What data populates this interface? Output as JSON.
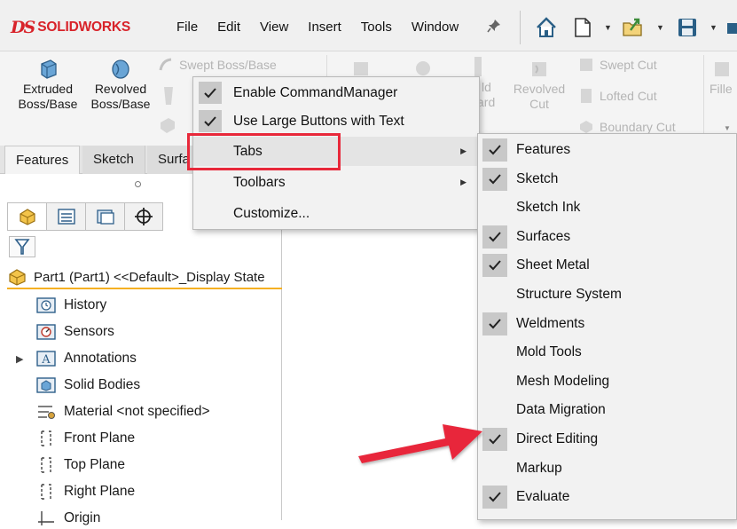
{
  "app": {
    "brand_ds": "DS",
    "brand_name_bold": "SOLID",
    "brand_name_rest": "WORKS",
    "accent_color": "#d8232a"
  },
  "menubar": {
    "items": [
      "File",
      "Edit",
      "View",
      "Insert",
      "Tools",
      "Window"
    ],
    "icons": [
      "pin-icon",
      "home-icon",
      "new-document-icon",
      "open-folder-icon",
      "save-icon"
    ]
  },
  "ribbon": {
    "extruded": "Extruded\nBoss/Base",
    "extruded_l1": "Extruded",
    "extruded_l2": "Boss/Base",
    "revolved_l1": "Revolved",
    "revolved_l2": "Boss/Base",
    "swept_boss": "Swept Boss/Base",
    "revolved_cut_l1": "Revolved",
    "revolved_cut_l2": "Cut",
    "swept_cut": "Swept Cut",
    "lofted_cut": "Lofted Cut",
    "boundary_cut": "Boundary Cut",
    "fillet_partial": "Fille",
    "partial_ld": "ld",
    "partial_ard": "ard"
  },
  "tabs": {
    "features": "Features",
    "sketch": "Sketch",
    "surfaces_partial": "Surfa"
  },
  "context_menu": {
    "items": [
      {
        "label": "Enable CommandManager",
        "checked": true,
        "submenu": false
      },
      {
        "label": "Use Large Buttons with Text",
        "checked": true,
        "submenu": false
      },
      {
        "label": "Tabs",
        "checked": false,
        "submenu": true
      },
      {
        "label": "Toolbars",
        "checked": false,
        "submenu": true
      },
      {
        "label": "Customize...",
        "checked": false,
        "submenu": false
      }
    ]
  },
  "tabs_submenu": {
    "items": [
      {
        "label": "Features",
        "checked": true
      },
      {
        "label": "Sketch",
        "checked": true
      },
      {
        "label": "Sketch Ink",
        "checked": false
      },
      {
        "label": "Surfaces",
        "checked": true
      },
      {
        "label": "Sheet Metal",
        "checked": true
      },
      {
        "label": "Structure System",
        "checked": false
      },
      {
        "label": "Weldments",
        "checked": true
      },
      {
        "label": "Mold Tools",
        "checked": false
      },
      {
        "label": "Mesh Modeling",
        "checked": false
      },
      {
        "label": "Data Migration",
        "checked": false
      },
      {
        "label": "Direct Editing",
        "checked": true
      },
      {
        "label": "Markup",
        "checked": false
      },
      {
        "label": "Evaluate",
        "checked": true
      }
    ]
  },
  "feature_tree": {
    "part": "Part1 (Part1) <<Default>_Display State",
    "items": [
      {
        "label": "History",
        "icon": "history-folder-icon"
      },
      {
        "label": "Sensors",
        "icon": "sensors-icon"
      },
      {
        "label": "Annotations",
        "icon": "annotations-icon"
      },
      {
        "label": "Solid Bodies",
        "icon": "solid-bodies-icon"
      },
      {
        "label": "Material <not specified>",
        "icon": "material-icon"
      },
      {
        "label": "Front Plane",
        "icon": "plane-icon"
      },
      {
        "label": "Top Plane",
        "icon": "plane-icon"
      },
      {
        "label": "Right Plane",
        "icon": "plane-icon"
      },
      {
        "label": "Origin",
        "icon": "origin-icon"
      }
    ]
  },
  "annotation_color": "#e8283a"
}
